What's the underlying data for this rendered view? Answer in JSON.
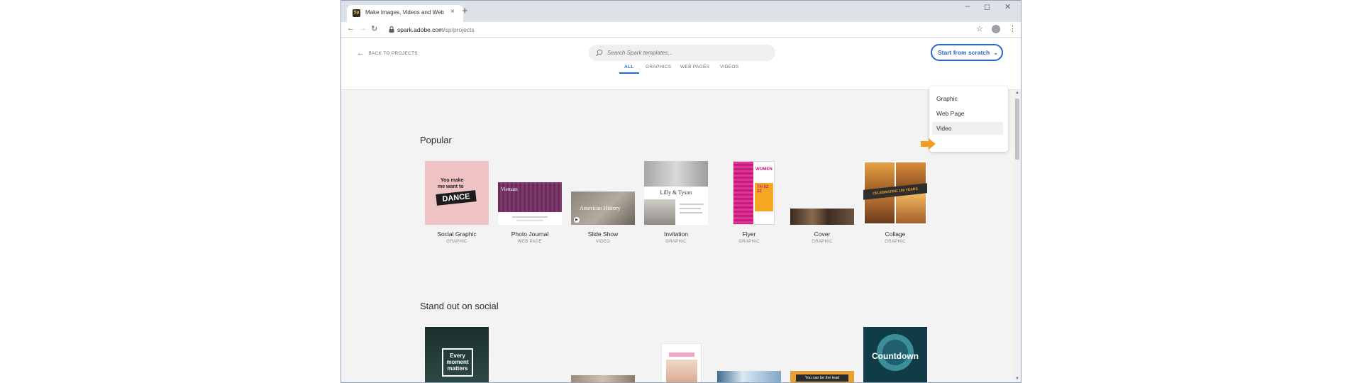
{
  "browser": {
    "tab_title": "Make Images, Videos and Web S",
    "tab_close": "×",
    "new_tab": "+",
    "url_domain": "spark.adobe.com",
    "url_path": "/sp/projects"
  },
  "header": {
    "back_label": "BACK TO PROJECTS",
    "search_placeholder": "Search Spark templates...",
    "scratch_label": "Start from scratch"
  },
  "filters": [
    "ALL",
    "GRAPHICS",
    "WEB PAGES",
    "VIDEOS"
  ],
  "dropdown": {
    "items": [
      "Graphic",
      "Web Page",
      "Video"
    ]
  },
  "sections": {
    "popular": {
      "title": "Popular",
      "cards": [
        {
          "label": "Social Graphic",
          "type": "GRAPHIC"
        },
        {
          "label": "Photo Journal",
          "type": "WEB PAGE"
        },
        {
          "label": "Slide Show",
          "type": "VIDEO"
        },
        {
          "label": "Invitation",
          "type": "GRAPHIC"
        },
        {
          "label": "Flyer",
          "type": "GRAPHIC"
        },
        {
          "label": "Cover",
          "type": "GRAPHIC"
        },
        {
          "label": "Collage",
          "type": "GRAPHIC"
        }
      ]
    },
    "social": {
      "title": "Stand out on social"
    }
  },
  "thumb_text": {
    "social_graphic_line1": "You make",
    "social_graphic_line2": "me want to",
    "social_graphic_line3": "DANCE",
    "photo_journal": "Vietnam",
    "slide_show": "American History",
    "invitation": "Lilly & Tyson",
    "flyer_title": "WOMEN",
    "flyer_date": "TH 02 22",
    "collage": "CELEBRATING 100 YEARS",
    "every_moment": "Every moment matters",
    "countdown": "Countdown",
    "lead": "You can be the lead"
  },
  "colors": {
    "accent": "#2a69c4",
    "pointer": "#f39c1e",
    "content_bg": "#f3f3f3"
  }
}
